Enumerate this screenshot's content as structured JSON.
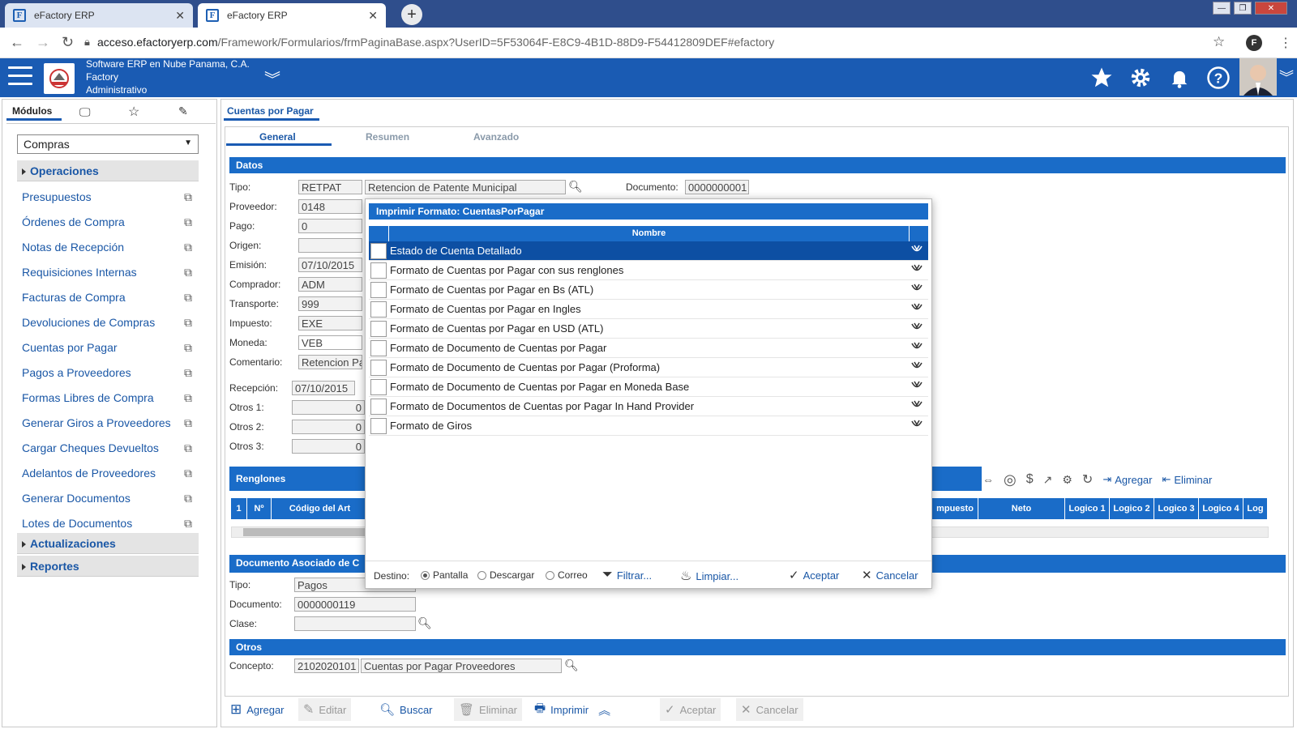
{
  "browser": {
    "tabs": [
      {
        "title": "eFactory ERP"
      },
      {
        "title": "eFactory ERP"
      }
    ],
    "url_host": "acceso.efactoryerp.com",
    "url_path": "/Framework/Formularios/frmPaginaBase.aspx?UserID=5F53064F-E8C9-4B1D-88D9-F54412809DEF#efactory"
  },
  "header": {
    "company": "Software ERP en Nube Panama, C.A.",
    "line2": "Factory",
    "line3": "Administrativo"
  },
  "sidebar": {
    "tabs": {
      "modules": "Módulos"
    },
    "module_select": "Compras",
    "sections": {
      "operaciones": "Operaciones",
      "actualizaciones": "Actualizaciones",
      "reportes": "Reportes"
    },
    "items": [
      "Presupuestos",
      "Órdenes de Compra",
      "Notas de Recepción",
      "Requisiciones Internas",
      "Facturas de Compra",
      "Devoluciones de Compras",
      "Cuentas por Pagar",
      "Pagos a Proveedores",
      "Formas Libres de Compra",
      "Generar Giros a Proveedores",
      "Cargar Cheques Devueltos",
      "Adelantos de Proveedores",
      "Generar Documentos",
      "Lotes de Documentos"
    ]
  },
  "main": {
    "title": "Cuentas por Pagar",
    "tabs": [
      "General",
      "Resumen",
      "Avanzado"
    ],
    "sections": {
      "datos": "Datos",
      "renglones": "Renglones",
      "doc_asociado": "Documento Asociado de C",
      "otros": "Otros"
    },
    "labels": {
      "tipo": "Tipo:",
      "proveedor": "Proveedor:",
      "pago": "Pago:",
      "origen": "Origen:",
      "emision": "Emisión:",
      "comprador": "Comprador:",
      "transporte": "Transporte:",
      "impuesto": "Impuesto:",
      "moneda": "Moneda:",
      "comentario": "Comentario:",
      "recepcion": "Recepción:",
      "otros1": "Otros 1:",
      "otros2": "Otros 2:",
      "otros3": "Otros 3:",
      "documento": "Documento:",
      "tipo2": "Tipo:",
      "documento2": "Documento:",
      "clase": "Clase:",
      "concepto": "Concepto:"
    },
    "values": {
      "tipo_code": "RETPAT",
      "tipo_desc": "Retencion de Patente Municipal",
      "documento": "0000000001",
      "proveedor": "0148",
      "pago": "0",
      "origen": "",
      "emision": "07/10/2015",
      "comprador": "ADM",
      "transporte": "999",
      "impuesto": "EXE",
      "moneda": "VEB",
      "comentario": "Retencion Pa",
      "recepcion": "07/10/2015",
      "otros1": "0",
      "otros2": "0",
      "otros3": "0",
      "tipo2": "Pagos",
      "documento2": "0000000119",
      "clase": "",
      "concepto_code": "2102020101",
      "concepto_desc": "Cuentas por Pagar Proveedores"
    },
    "grid": {
      "headers": [
        "1",
        "Nº",
        "Código del Art",
        "mpuesto",
        "Neto",
        "Logico 1",
        "Logico 2",
        "Logico 3",
        "Logico 4",
        "Log"
      ],
      "toolbar": {
        "add": "Agregar",
        "delete": "Eliminar"
      }
    },
    "bottom_bar": [
      "Agregar",
      "Editar",
      "Buscar",
      "Eliminar",
      "Imprimir",
      "Aceptar",
      "Cancelar"
    ]
  },
  "dialog": {
    "title": "Imprimir Formato: CuentasPorPagar",
    "column": "Nombre",
    "rows": [
      "Estado de Cuenta Detallado",
      "Formato de Cuentas por Pagar con sus renglones",
      "Formato de Cuentas por Pagar en Bs (ATL)",
      "Formato de Cuentas por Pagar en Ingles",
      "Formato de Cuentas por Pagar en USD (ATL)",
      "Formato de Documento de Cuentas por Pagar",
      "Formato de Documento de Cuentas por Pagar (Proforma)",
      "Formato de Documento de Cuentas por Pagar en Moneda Base",
      "Formato de Documentos de Cuentas por Pagar In Hand Provider",
      "Formato de Giros"
    ],
    "footer": {
      "destino": "Destino:",
      "pantalla": "Pantalla",
      "descargar": "Descargar",
      "correo": "Correo",
      "filtrar": "Filtrar...",
      "limpiar": "Limpiar...",
      "aceptar": "Aceptar",
      "cancelar": "Cancelar"
    }
  },
  "colors": {
    "brand": "#1a5bb3",
    "section": "#1a6cc8",
    "selected_row": "#0d4fa3",
    "link": "#1a57a6"
  }
}
